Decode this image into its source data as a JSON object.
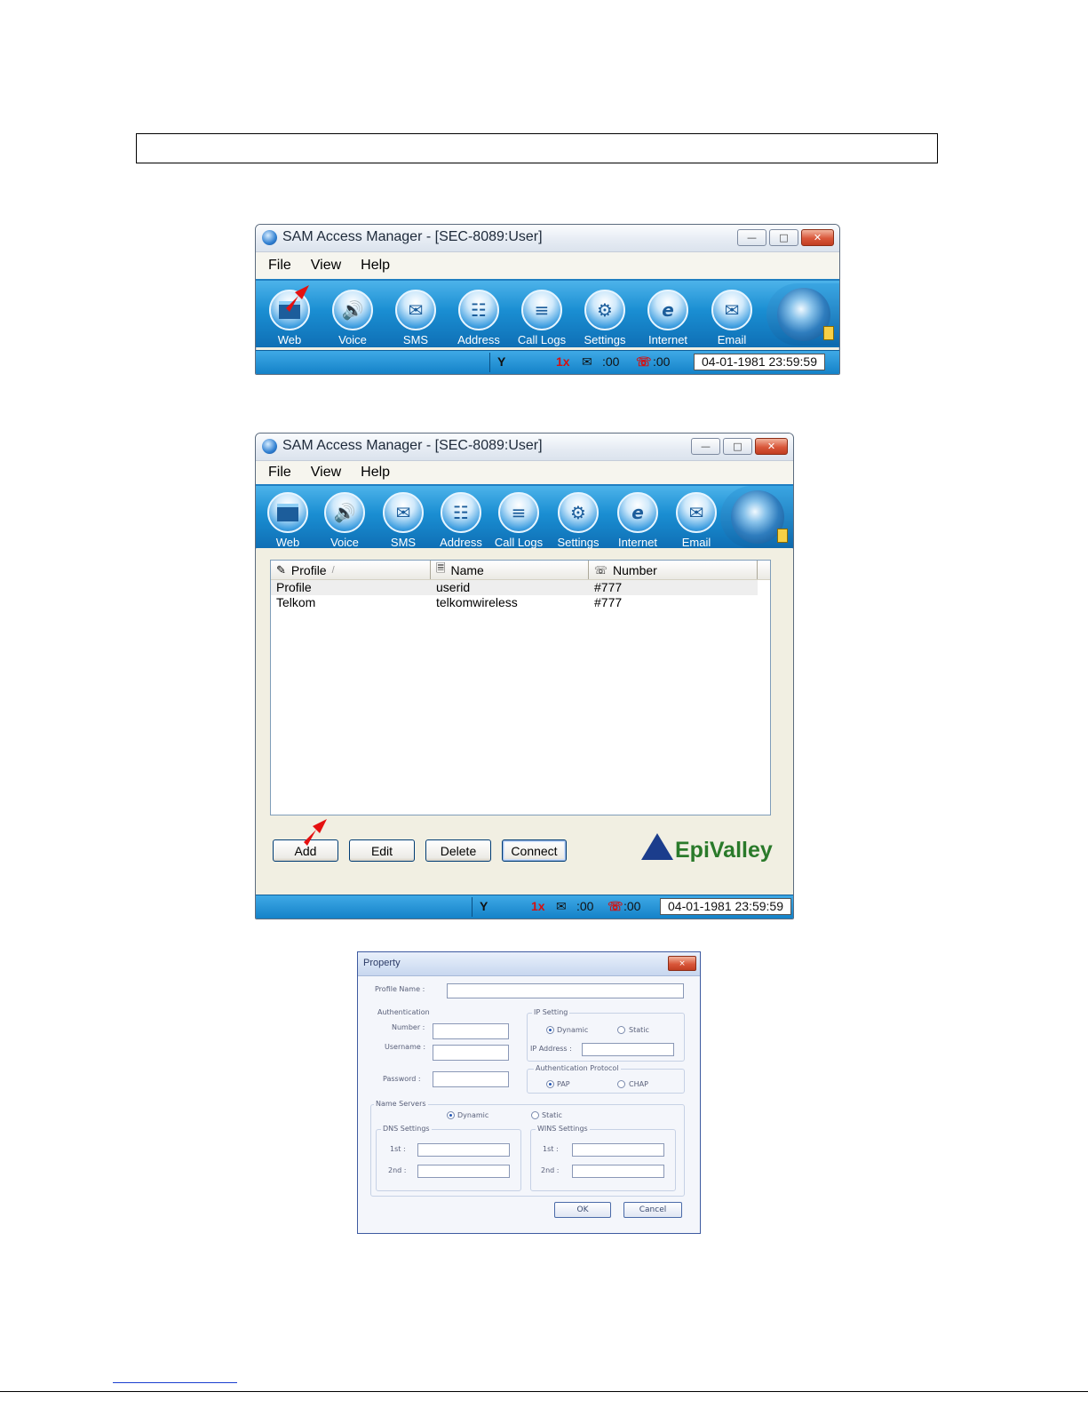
{
  "window1": {
    "title": "SAM Access Manager - [SEC-8089:User]",
    "menu": [
      "File",
      "View",
      "Help"
    ],
    "toolbar": [
      {
        "label": "Web",
        "icon": "web-icon"
      },
      {
        "label": "Voice",
        "icon": "speaker-icon"
      },
      {
        "label": "SMS",
        "icon": "envelope-icon"
      },
      {
        "label": "Address",
        "icon": "address-book-icon"
      },
      {
        "label": "Call Logs",
        "icon": "call-logs-icon"
      },
      {
        "label": "Settings",
        "icon": "gear-icon"
      },
      {
        "label": "Internet",
        "icon": "internet-explorer-icon"
      },
      {
        "label": "Email",
        "icon": "email-icon"
      }
    ],
    "status": {
      "network": "1x",
      "sms_count": ":00",
      "call_count": ":00",
      "datetime": "04-01-1981 23:59:59"
    }
  },
  "window2": {
    "title": "SAM Access Manager - [SEC-8089:User]",
    "menu": [
      "File",
      "View",
      "Help"
    ],
    "toolbar": [
      {
        "label": "Web",
        "icon": "web-icon"
      },
      {
        "label": "Voice",
        "icon": "speaker-icon"
      },
      {
        "label": "SMS",
        "icon": "envelope-icon"
      },
      {
        "label": "Address",
        "icon": "address-book-icon"
      },
      {
        "label": "Call Logs",
        "icon": "call-logs-icon"
      },
      {
        "label": "Settings",
        "icon": "gear-icon"
      },
      {
        "label": "Internet",
        "icon": "internet-explorer-icon"
      },
      {
        "label": "Email",
        "icon": "email-icon"
      }
    ],
    "columns": [
      "Profile",
      "Name",
      "Number"
    ],
    "rows": [
      [
        "Profile",
        "userid",
        "#777"
      ],
      [
        "Telkom",
        "telkomwireless",
        "#777"
      ]
    ],
    "buttons": {
      "add": "Add",
      "edit": "Edit",
      "delete": "Delete",
      "connect": "Connect"
    },
    "logo": "EpiValley",
    "status": {
      "network": "1x",
      "sms_count": ":00",
      "call_count": ":00",
      "datetime": "04-01-1981 23:59:59"
    }
  },
  "property_dialog": {
    "title": "Property",
    "close_label": "×",
    "profile_name_label": "Profile Name :",
    "authentication": {
      "title": "Authentication",
      "number_label": "Number :",
      "username_label": "Username :",
      "password_label": "Password :"
    },
    "ip_setting": {
      "title": "IP Setting",
      "dynamic": "Dynamic",
      "static": "Static",
      "ip_address_label": "IP Address :",
      "selected": "Dynamic"
    },
    "auth_protocol": {
      "title": "Authentication Protocol",
      "pap": "PAP",
      "chap": "CHAP",
      "selected": "PAP"
    },
    "name_servers": {
      "title": "Name Servers",
      "dynamic": "Dynamic",
      "static": "Static",
      "selected": "Dynamic",
      "dns_title": "DNS Settings",
      "wins_title": "WINS Settings",
      "first_label": "1st :",
      "second_label": "2nd :"
    },
    "ok": "OK",
    "cancel": "Cancel"
  },
  "colors": {
    "toolbar_blue": "#1a8ed2",
    "pointer_arrow": "#e51010",
    "logo_green": "#2a7a2a"
  }
}
